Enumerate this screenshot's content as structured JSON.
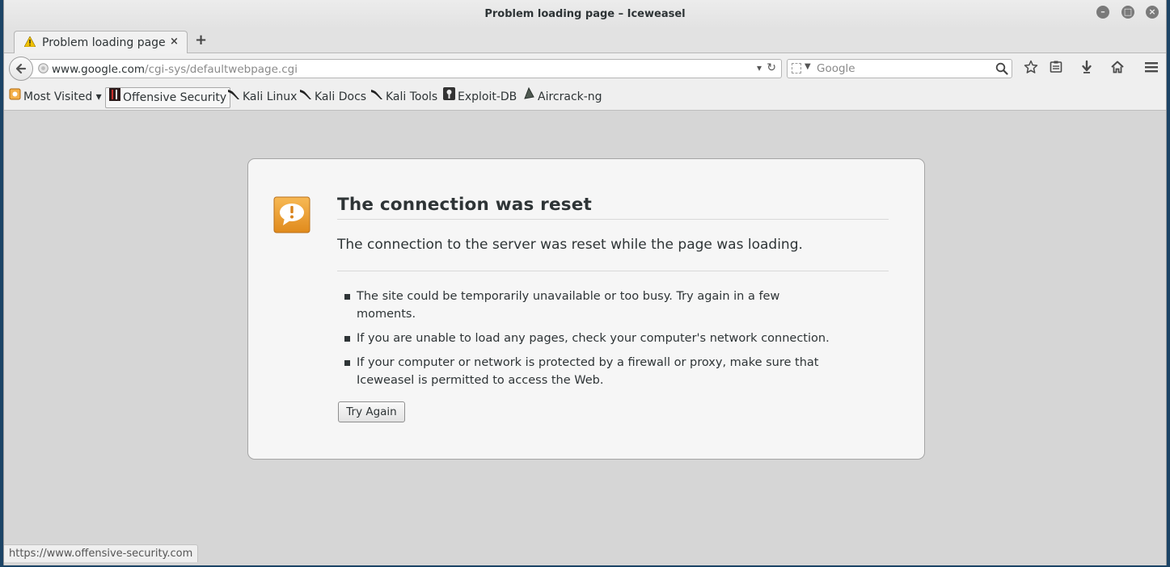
{
  "window": {
    "title": "Problem loading page – Iceweasel"
  },
  "tabs": [
    {
      "label": "Problem loading page",
      "close": "×"
    }
  ],
  "new_tab_label": "+",
  "navbar": {
    "url_host": "www.google.com",
    "url_path": "/cgi-sys/defaultwebpage.cgi",
    "search_placeholder": "Google"
  },
  "bookmarks": [
    {
      "label": "Most Visited ▾"
    },
    {
      "label": "Offensive Security"
    },
    {
      "label": "Kali Linux"
    },
    {
      "label": "Kali Docs"
    },
    {
      "label": "Kali Tools"
    },
    {
      "label": "Exploit-DB"
    },
    {
      "label": "Aircrack-ng"
    }
  ],
  "error": {
    "title": "The connection was reset",
    "subtitle": "The connection to the server was reset while the page was loading.",
    "bullets": [
      "The site could be temporarily unavailable or too busy. Try again in a few moments.",
      "If you are unable to load any pages, check your computer's network connection.",
      "If your computer or network is protected by a firewall or proxy, make sure that Iceweasel is permitted to access the Web."
    ],
    "button": "Try Again"
  },
  "status": {
    "text": "https://www.offensive-security.com"
  },
  "colors": {
    "warning_orange": "#f0a43a",
    "page_background": "#d6d6d6",
    "desktop": "#1c4466"
  }
}
